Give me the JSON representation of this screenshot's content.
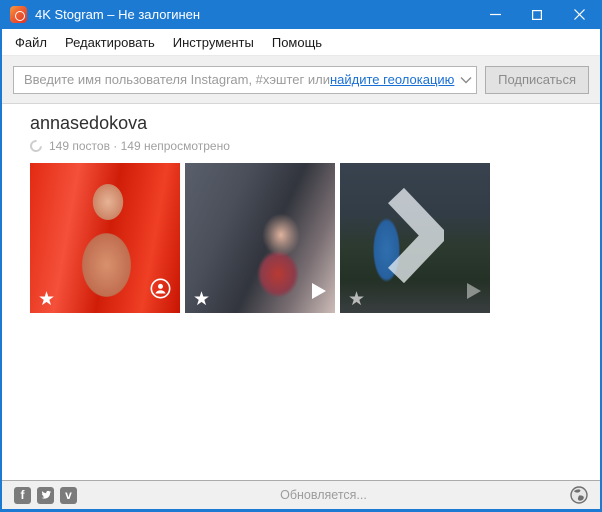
{
  "colors": {
    "titlebar_blue": "#1d7ad3",
    "link_blue": "#1a6fd4",
    "app_icon_orange": "#ee5f31",
    "toolbar_gray": "#f0f0f0"
  },
  "window": {
    "title": "4K Stogram – Не залогинен"
  },
  "menu": {
    "items": [
      "Файл",
      "Редактировать",
      "Инструменты",
      "Помощь"
    ]
  },
  "toolbar": {
    "placeholder_text": "Введите имя пользователя Instagram, #хэштег или ",
    "placeholder_link": "найдите геолокацию",
    "subscribe_button": "Подписаться"
  },
  "account": {
    "username": "annasedokova",
    "stats": "149 постов · 149 непросмотрено"
  },
  "posts": [
    {
      "subject": "woman in red",
      "badges": [
        "favorite-star",
        "tagged-user"
      ],
      "star": "★"
    },
    {
      "subject": "child at table",
      "badges": [
        "favorite-star",
        "play"
      ],
      "star": "★"
    },
    {
      "subject": "woman in blue dress",
      "badges": [
        "favorite-star",
        "play"
      ],
      "overlay": "next-chevron",
      "star": "★"
    }
  ],
  "statusbar": {
    "status": "Обновляется...",
    "social": [
      "facebook",
      "twitter",
      "vimeo"
    ],
    "facebook_glyph": "f",
    "vimeo_glyph": "v"
  }
}
